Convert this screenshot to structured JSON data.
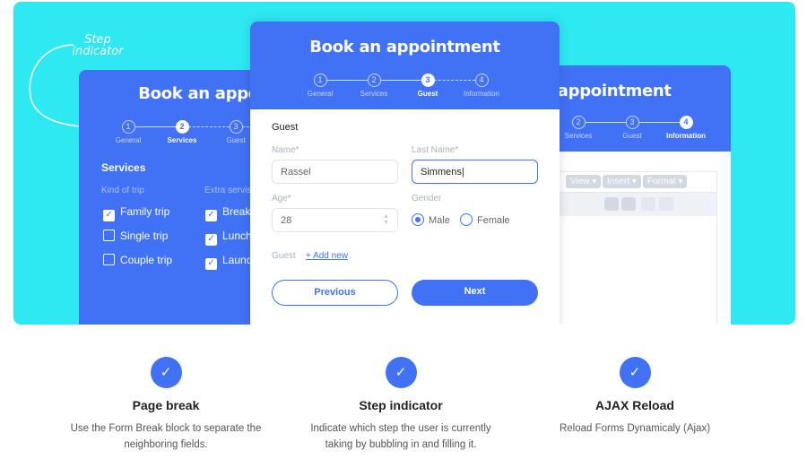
{
  "annotation": "Step indicator",
  "colors": {
    "accent": "#4171f5",
    "background": "#2ee8f2"
  },
  "steps": [
    "General",
    "Services",
    "Guest",
    "Information"
  ],
  "form_title": "Book an appointment",
  "left_card": {
    "active_step": 2,
    "section": "Services",
    "kind_label": "Kind of trip",
    "extra_label": "Extra servis",
    "kinds": [
      {
        "label": "Family trip",
        "checked": true
      },
      {
        "label": "Single trip",
        "checked": false
      },
      {
        "label": "Couple trip",
        "checked": false
      }
    ],
    "extras": [
      {
        "label": "Breakfast",
        "checked": true
      },
      {
        "label": "Lunch",
        "checked": true
      },
      {
        "label": "Laundry",
        "checked": true
      }
    ]
  },
  "middle_card": {
    "active_step": 3,
    "section": "Guest",
    "name_label": "Name*",
    "name_value": "Rassel",
    "last_name_label": "Last Name*",
    "last_name_value": "Simmens|",
    "age_label": "Age*",
    "age_value": "28",
    "gender_label": "Gender",
    "gender_options": [
      "Male",
      "Female"
    ],
    "gender_selected": "Male",
    "guest_label": "Guest",
    "add_new": "+ Add new",
    "previous": "Previous",
    "next": "Next"
  },
  "right_card": {
    "active_step": 4,
    "menu": [
      "View",
      "Insert",
      "Format"
    ]
  },
  "features": [
    {
      "icon": "check-icon",
      "title": "Page break",
      "desc": "Use the Form Break block to separate the neighboring fields."
    },
    {
      "icon": "check-icon",
      "title": "Step indicator",
      "desc": "Indicate which step the user is currently taking by bubbling in and filling it."
    },
    {
      "icon": "check-icon",
      "title": "AJAX Reload",
      "desc": "Reload Forms Dynamicaly (Ajax)"
    }
  ]
}
